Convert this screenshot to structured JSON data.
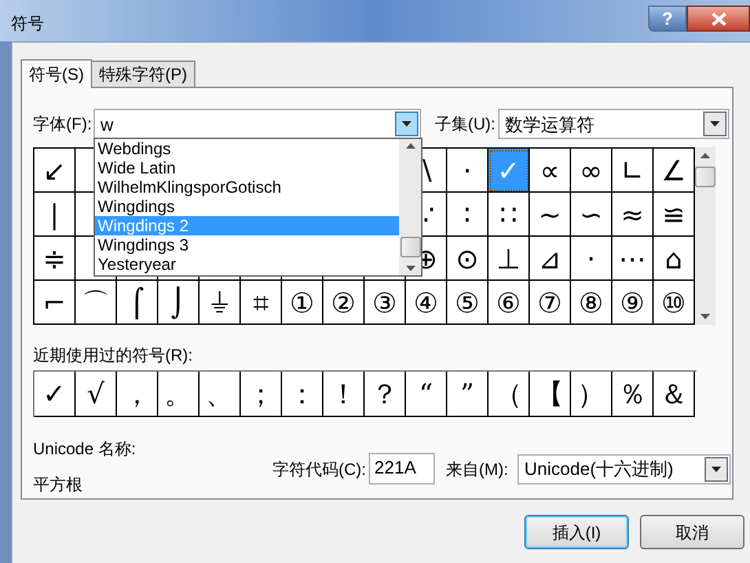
{
  "window": {
    "title": "符号",
    "help": "?"
  },
  "tabs": [
    {
      "label": "符号(S)",
      "selected": true
    },
    {
      "label": "特殊字符(P)",
      "selected": false
    }
  ],
  "font_field": {
    "label": "字体(F):",
    "value": "w"
  },
  "subset_field": {
    "label": "子集(U):",
    "value": "数学运算符"
  },
  "font_list": {
    "items": [
      {
        "label": "Webdings",
        "selected": false
      },
      {
        "label": "Wide Latin",
        "selected": false
      },
      {
        "label": "WilhelmKlingsporGotisch",
        "selected": false
      },
      {
        "label": "Wingdings",
        "selected": false
      },
      {
        "label": "Wingdings 2",
        "selected": true
      },
      {
        "label": "Wingdings 3",
        "selected": false
      },
      {
        "label": "Yesteryear",
        "selected": false
      }
    ]
  },
  "symbol_grid": {
    "rows": [
      {
        "left": [
          {
            "symbol": "↙",
            "selected": false
          }
        ],
        "right": [
          {
            "symbol": "∖",
            "selected": false
          },
          {
            "symbol": "·",
            "selected": false
          },
          {
            "symbol": "✓",
            "selected": true
          },
          {
            "symbol": "∝",
            "selected": false
          },
          {
            "symbol": "∞",
            "selected": false
          },
          {
            "symbol": "∟",
            "selected": false
          },
          {
            "symbol": "∠",
            "selected": false
          }
        ]
      },
      {
        "left": [
          {
            "symbol": "∣",
            "selected": false
          }
        ],
        "right": [
          {
            "symbol": "∵",
            "selected": false
          },
          {
            "symbol": "∶",
            "selected": false
          },
          {
            "symbol": "∷",
            "selected": false
          },
          {
            "symbol": "∼",
            "selected": false
          },
          {
            "symbol": "∽",
            "selected": false
          },
          {
            "symbol": "≈",
            "selected": false
          },
          {
            "symbol": "≌",
            "selected": false
          }
        ]
      },
      {
        "left": [
          {
            "symbol": "≑",
            "selected": false
          }
        ],
        "right": [
          {
            "symbol": "⊕",
            "selected": false
          },
          {
            "symbol": "⊙",
            "selected": false
          },
          {
            "symbol": "⊥",
            "selected": false
          },
          {
            "symbol": "⊿",
            "selected": false
          },
          {
            "symbol": "·",
            "selected": false
          },
          {
            "symbol": "⋯",
            "selected": false
          },
          {
            "symbol": "⌂",
            "selected": false
          }
        ]
      },
      {
        "left": [
          {
            "symbol": "⌐",
            "selected": false
          },
          {
            "symbol": "⌒",
            "selected": false
          },
          {
            "symbol": "⌠",
            "selected": false
          },
          {
            "symbol": "⌡",
            "selected": false
          },
          {
            "symbol": "⏚",
            "selected": false
          },
          {
            "symbol": "⌗",
            "selected": false
          },
          {
            "symbol": "①",
            "selected": false
          },
          {
            "symbol": "②",
            "selected": false
          },
          {
            "symbol": "③",
            "selected": false
          },
          {
            "symbol": "④",
            "selected": false
          },
          {
            "symbol": "⑤",
            "selected": false
          },
          {
            "symbol": "⑥",
            "selected": false
          },
          {
            "symbol": "⑦",
            "selected": false
          },
          {
            "symbol": "⑧",
            "selected": false
          },
          {
            "symbol": "⑨",
            "selected": false
          },
          {
            "symbol": "⑩",
            "selected": false
          }
        ],
        "right": []
      }
    ]
  },
  "recent": {
    "label": "近期使用过的符号(R):",
    "symbols": [
      "✓",
      "√",
      "，",
      "。",
      "、",
      "；",
      "：",
      "！",
      "？",
      "“",
      "”",
      "（",
      "【",
      "）",
      "％",
      "＆"
    ]
  },
  "unicode_name": {
    "label": "Unicode 名称:",
    "value": "平方根"
  },
  "char_code": {
    "label": "字符代码(C):",
    "value": "221A"
  },
  "from_field": {
    "label": "来自(M):",
    "value": "Unicode(十六进制)"
  },
  "buttons": [
    {
      "label": "插入(I)",
      "focused": true
    },
    {
      "label": "取消",
      "focused": false
    }
  ]
}
